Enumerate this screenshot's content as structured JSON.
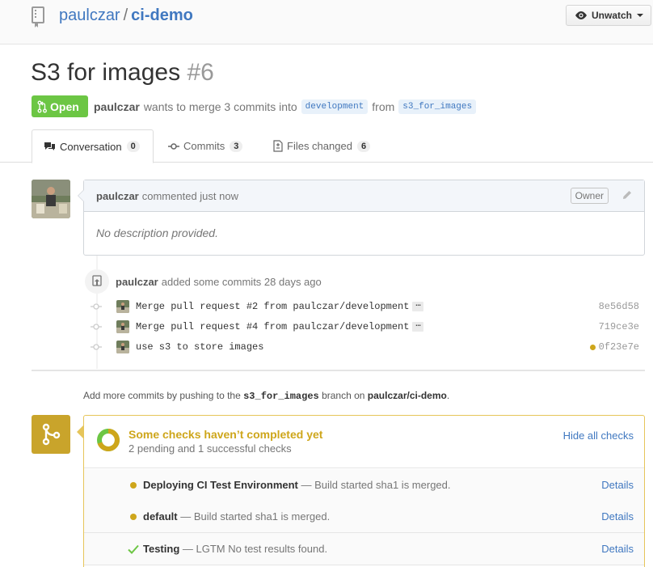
{
  "repo": {
    "owner": "paulczar",
    "separator": "/",
    "name": "ci-demo",
    "watch_button": "Unwatch"
  },
  "pr": {
    "title": "S3 for images",
    "number": "#6",
    "state": "Open",
    "author": "paulczar",
    "merge_text": "wants to merge 3 commits into",
    "base_branch": "development",
    "from_text": "from",
    "head_branch": "s3_for_images"
  },
  "tabs": [
    {
      "label": "Conversation",
      "count": "0"
    },
    {
      "label": "Commits",
      "count": "3"
    },
    {
      "label": "Files changed",
      "count": "6"
    }
  ],
  "comment": {
    "author": "paulczar",
    "action": "commented just now",
    "badge": "Owner",
    "body": "No description provided."
  },
  "push_event": {
    "author": "paulczar",
    "text": "added some commits 28 days ago"
  },
  "commits": [
    {
      "message": "Merge pull request #2 from paulczar/development",
      "ellipsis": "…",
      "sha": "8e56d58",
      "status": ""
    },
    {
      "message": "Merge pull request #4 from paulczar/development",
      "ellipsis": "…",
      "sha": "719ce3e",
      "status": ""
    },
    {
      "message": "use s3 to store images",
      "ellipsis": "",
      "sha": "0f23e7e",
      "status": "pending"
    }
  ],
  "add_commits": {
    "prefix": "Add more commits by pushing to the",
    "branch": "s3_for_images",
    "middle": "branch on",
    "repo": "paulczar/ci-demo",
    "suffix": "."
  },
  "status": {
    "title": "Some checks haven’t completed yet",
    "subtitle": "2 pending and 1 successful checks",
    "toggle": "Hide all checks",
    "checks": [
      {
        "name": "Deploying CI Test Environment",
        "description": "— Build started sha1 is merged.",
        "state": "pending",
        "link": "Details"
      },
      {
        "name": "default",
        "description": "— Build started sha1 is merged.",
        "state": "pending",
        "link": "Details"
      },
      {
        "name": "Testing",
        "description": "— LGTM No test results found.",
        "state": "success",
        "link": "Details"
      }
    ]
  },
  "colors": {
    "link": "#4078c0",
    "open": "#6cc644",
    "pending": "#cea61b",
    "success": "#6cc644"
  }
}
